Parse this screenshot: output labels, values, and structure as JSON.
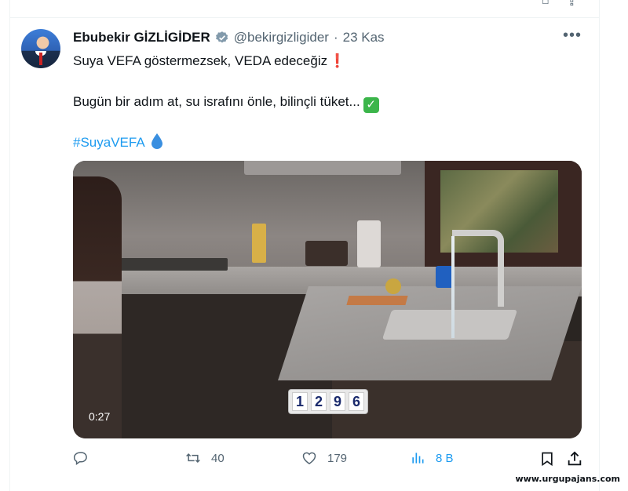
{
  "tweet": {
    "author_name": "Ebubekir GİZLİGİDER",
    "handle": "@bekirgizligider",
    "separator": "·",
    "date": "23 Kas",
    "line1": "Suya VEFA göstermezsek, VEDA edeceğiz",
    "line2": "Bugün bir adım at, su israfını önle, bilinçli tüket...",
    "hashtag": "#SuyaVEFA",
    "more_label": "•••"
  },
  "video": {
    "duration": "0:27",
    "counter_digits": [
      "1",
      "2",
      "9",
      "6"
    ]
  },
  "actions": {
    "replies": "",
    "retweets": "40",
    "likes": "179",
    "views": "8 B"
  },
  "watermark": "www.urgupajans.com",
  "colors": {
    "accent": "#1d9bf0",
    "secondary_text": "#536471",
    "verified_badge": "#829aab"
  },
  "icons": {
    "verified": "verified-badge-icon",
    "reply": "reply-icon",
    "retweet": "retweet-icon",
    "like": "heart-icon",
    "views": "views-chart-icon",
    "bookmark": "bookmark-icon",
    "share": "share-icon"
  }
}
